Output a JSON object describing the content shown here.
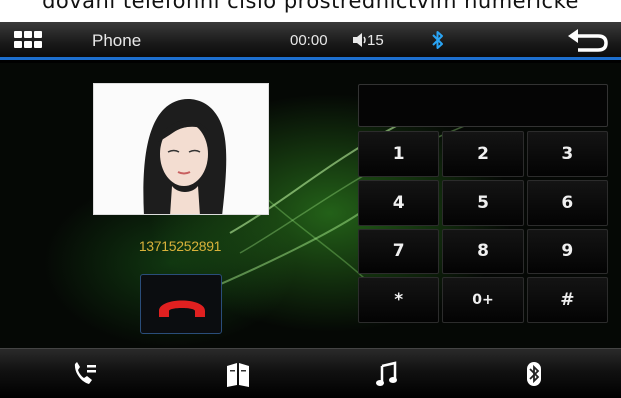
{
  "document": {
    "cropped_text": "dování  telefonní  číslo  prostřednictvím  numerické"
  },
  "statusbar": {
    "title": "Phone",
    "clock": "00:00",
    "volume": "15",
    "icons": {
      "menu": "grid-menu-icon",
      "volume": "speaker-icon",
      "bluetooth": "bluetooth-icon",
      "back": "back-arrow-icon"
    }
  },
  "call": {
    "phone_number": "13715252891",
    "contact_photo": "woman-portrait",
    "hangup_icon": "hangup-phone-icon",
    "hangup_color": "#e02020"
  },
  "keypad": {
    "keys": [
      "1",
      "2",
      "3",
      "4",
      "5",
      "6",
      "7",
      "8",
      "9",
      "*",
      "0+",
      "#"
    ]
  },
  "bottombar": {
    "items": [
      {
        "name": "call-log",
        "icon": "phone-log-icon"
      },
      {
        "name": "contacts",
        "icon": "phonebook-icon"
      },
      {
        "name": "music",
        "icon": "music-note-icon"
      },
      {
        "name": "bluetooth",
        "icon": "bluetooth-icon"
      }
    ]
  },
  "colors": {
    "accent": "#1d6fcf",
    "number": "#d8b23a",
    "bluetooth": "#2aa4f4",
    "glow": "#4caf2a"
  }
}
